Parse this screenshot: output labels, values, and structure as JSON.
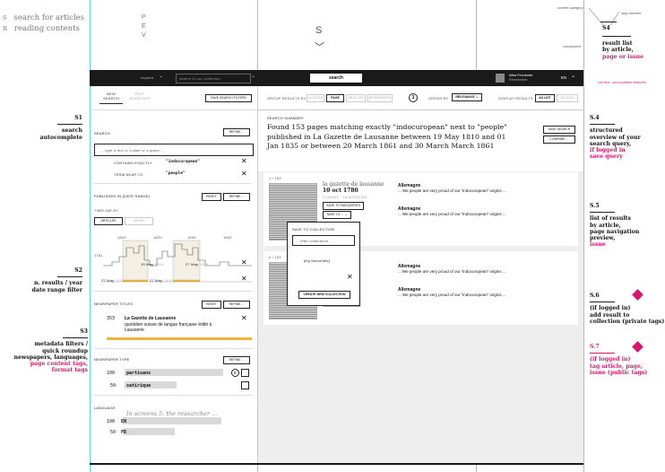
{
  "legend": {
    "s_key": "S",
    "s_label": "search for articles",
    "r_key": "R",
    "r_label": "reading contents",
    "pev": [
      "P",
      "E",
      "V"
    ]
  },
  "screen_marker": {
    "letter": "S"
  },
  "meta_labels": {
    "screen_category": "screen category",
    "step_number": "step number",
    "component": "component",
    "red_text": "red text: uncompleted features"
  },
  "step_box": {
    "id": "S4",
    "text": [
      "result list",
      "by article,"
    ],
    "pink": "page or issue"
  },
  "left_annotations": [
    {
      "id": "S1",
      "lines": [
        "search",
        "autocomplete"
      ],
      "pink": []
    },
    {
      "id": "S2",
      "lines": [
        "n. results / year",
        "date range filter"
      ],
      "pink": []
    },
    {
      "id": "S3",
      "lines": [
        "metadata filters /",
        "quick roundup",
        "newspapers, languages,"
      ],
      "pink": [
        "page content tags,",
        "format tags"
      ]
    }
  ],
  "right_annotations": [
    {
      "id": "S.4",
      "lines": [
        "structured",
        "overview of your",
        "search query,"
      ],
      "pink": [
        "if logged in",
        "save query"
      ]
    },
    {
      "id": "S.5",
      "lines": [
        "list of results",
        "by article,",
        "page navigation",
        "preview,"
      ],
      "pink": [
        "issue"
      ]
    },
    {
      "id": "S.6",
      "lines": [
        "(if logged in)",
        "add result to",
        "collection (private tags)"
      ],
      "pink": []
    },
    {
      "id": "S.7",
      "lines": [
        "(if logged in)",
        "tag article, page,",
        "issue (public tags)"
      ],
      "pink": []
    }
  ],
  "topbar": {
    "explore": "explore",
    "search_placeholder": "search in our collection",
    "search_btn": "search",
    "user_name": "Alba Ferracher",
    "user_role": "Researcher",
    "lang": "EN"
  },
  "sidebar": {
    "tabs": [
      "NEW SEARCH",
      "PAST SEARCHES"
    ],
    "save_filters": "SAVE SEARCH FILTERS",
    "search_label": "SEARCH",
    "refine": "REFINE ...",
    "query_placeholder": "... type a text or a date or a query ...",
    "terms": [
      {
        "label": "CONTAINS EXACTLY:",
        "value": "\"indocuropean\""
      },
      {
        "label": "TERM NEAR TO:",
        "value": "\"people\""
      }
    ],
    "published_label": "PUBLISHED IN (DATE RANGE)",
    "reset": "RESET",
    "timeline_label": "TIMELINE BY",
    "timeline_opts": [
      "ARTICLES",
      "ISSUES"
    ],
    "years": [
      "1810",
      "1820",
      "1830",
      "1840"
    ],
    "year_left": "1781",
    "ranges": [
      {
        "from": "19 May",
        "fromy": "1810",
        "to": "27 May",
        "toy": "1820"
      },
      {
        "from": "27 May",
        "fromy": "1810",
        "to": "27 May",
        "toy": "1820"
      }
    ],
    "newspaper_titles_label": "NEWSPAPER TITLES",
    "newspaper": {
      "count": "353",
      "name": "La Gazette de Lausanne",
      "desc": "quotidien suisse de langue française édité à Lausanne"
    },
    "newspaper_type_label": "NEWSPAPER TYPE",
    "types": [
      {
        "count": "100",
        "name": "partisans"
      },
      {
        "count": "50",
        "name": "satirique"
      }
    ],
    "language_label": "LANGUAGE",
    "languages": [
      {
        "count": "100",
        "name": "EN"
      },
      {
        "count": "50",
        "name": "FR"
      }
    ],
    "ghost_text": "In screens 5, the researcher ..."
  },
  "results": {
    "group_label": "GROUP RESULTS BY",
    "groups": [
      "CLUSTER",
      "PAGE",
      "ARTICLES",
      "NEWSPAPERS"
    ],
    "order_label": "ORDER BY",
    "order_value": "RELEVANCE",
    "display_label": "DISPLAY RESULTS",
    "display": [
      "AS LIST",
      "AS TILES"
    ],
    "summary_label": "SEARCH SUMMARY",
    "summary": "Found 153 pages matching exactly \"indocuropean\" next to \"people\" published in La Gazette de Lausanne between 19 May 1810 and 01 Jan 1835 or between 20 March 1861 and 30 March March 1861",
    "save_search": "SAVE SEARCH",
    "compare": "COMPARE ...",
    "items": [
      {
        "index": "1 / 153",
        "title": "la gazette de lausanne",
        "date": "10 oct 1780",
        "meta": "3 LANGS · 18 ARTICLES",
        "save_btn": "SAVE TO FAVOURITES",
        "save_to": "SAVE TO ...",
        "hits": [
          {
            "head": "Allemagne",
            "text": "... We people are very proud of our \"indocuropean\" origins ..."
          },
          {
            "head": "Allemagne",
            "text": "... We people are very proud of our \"indocuropean\" origins ..."
          }
        ]
      },
      {
        "index": "2 / 153",
        "hits": [
          {
            "head": "Allemagne",
            "text": "... We people are very proud of our \"indocuropean\" origins ..."
          },
          {
            "head": "Allemagne",
            "text": "... We people are very proud of our \"indocuropean\" origins ..."
          }
        ]
      }
    ],
    "popup": {
      "title": "SAVE TO COLLECTION",
      "filter": "... filter collections ...",
      "fav": "[my favourites]",
      "create": "CREATE NEW COLLECTION"
    }
  },
  "colors": {
    "guide": "#5fd8e8",
    "pink": "#d6166a",
    "dark": "#1a1a1a",
    "accent": "#f0b23a"
  }
}
